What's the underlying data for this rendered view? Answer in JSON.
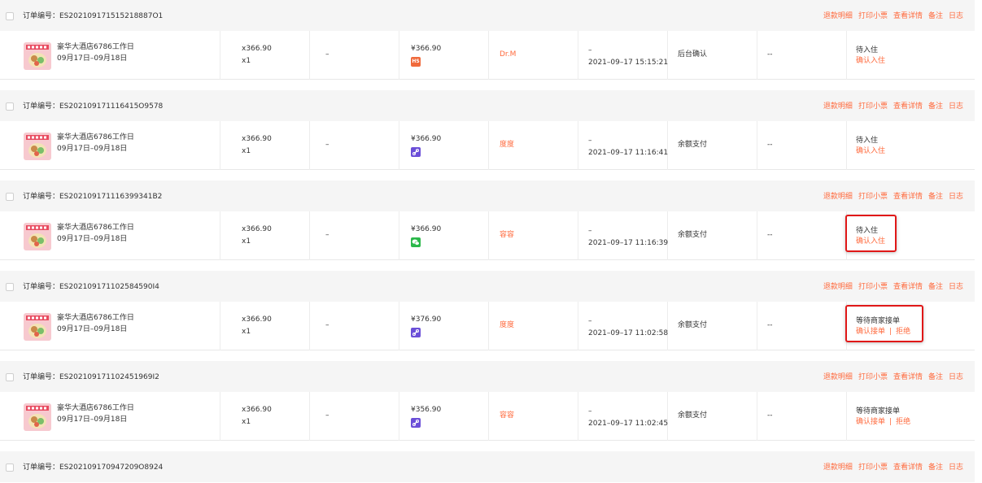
{
  "labels": {
    "order_no_label": "订单编号：",
    "actions": [
      "退款明细",
      "打印小票",
      "查看详情",
      "备注",
      "日志"
    ],
    "dash": "--",
    "en_dash": "–",
    "separator": "|"
  },
  "colors": {
    "accent": "#ff6a3d",
    "highlight": "#e01818",
    "hs_icon": "#f06a3c",
    "card_icon": "#6b4fd8",
    "wechat_icon": "#2bb84a"
  },
  "orders": [
    {
      "order_no": "ES202109171515218887O1",
      "product_name": "豪华大酒店6786工作日",
      "date_range": "09月17日–09月18日",
      "unit_price": "x366.90",
      "quantity": "x1",
      "paid_amount": "¥366.90",
      "pay_icon": "hs-pay-icon",
      "pay_icon_text": "HS",
      "buyer": "Dr.M",
      "time": "2021–09–17 15:15:21",
      "pay_method": "后台确认",
      "status": "待入住",
      "status_actions": [
        "确认入住"
      ],
      "highlight": false
    },
    {
      "order_no": "ES202109171116415O9578",
      "product_name": "豪华大酒店6786工作日",
      "date_range": "09月17日–09月18日",
      "unit_price": "x366.90",
      "quantity": "x1",
      "paid_amount": "¥366.90",
      "pay_icon": "card-pay-icon",
      "pay_icon_text": "",
      "buyer": "度度",
      "time": "2021–09–17 11:16:41",
      "pay_method": "余额支付",
      "status": "待入住",
      "status_actions": [
        "确认入住"
      ],
      "highlight": false
    },
    {
      "order_no": "ES202109171116399341B2",
      "product_name": "豪华大酒店6786工作日",
      "date_range": "09月17日–09月18日",
      "unit_price": "x366.90",
      "quantity": "x1",
      "paid_amount": "¥366.90",
      "pay_icon": "wechat-pay-icon",
      "pay_icon_text": "",
      "buyer": "容容",
      "time": "2021–09–17 11:16:39",
      "pay_method": "余额支付",
      "status": "待入住",
      "status_actions": [
        "确认入住"
      ],
      "highlight": true
    },
    {
      "order_no": "ES202109171102584590I4",
      "product_name": "豪华大酒店6786工作日",
      "date_range": "09月17日–09月18日",
      "unit_price": "x366.90",
      "quantity": "x1",
      "paid_amount": "¥376.90",
      "pay_icon": "card-pay-icon",
      "pay_icon_text": "",
      "buyer": "度度",
      "time": "2021–09–17 11:02:58",
      "pay_method": "余额支付",
      "status": "等待商家接单",
      "status_actions": [
        "确认接单",
        "拒绝"
      ],
      "highlight": true
    },
    {
      "order_no": "ES202109171102451969I2",
      "product_name": "豪华大酒店6786工作日",
      "date_range": "09月17日–09月18日",
      "unit_price": "x366.90",
      "quantity": "x1",
      "paid_amount": "¥356.90",
      "pay_icon": "card-pay-icon",
      "pay_icon_text": "",
      "buyer": "容容",
      "time": "2021–09–17 11:02:45",
      "pay_method": "余额支付",
      "status": "等待商家接单",
      "status_actions": [
        "确认接单",
        "拒绝"
      ],
      "highlight": false
    },
    {
      "order_no": "ES202109170947209O8924",
      "header_only": true
    }
  ]
}
